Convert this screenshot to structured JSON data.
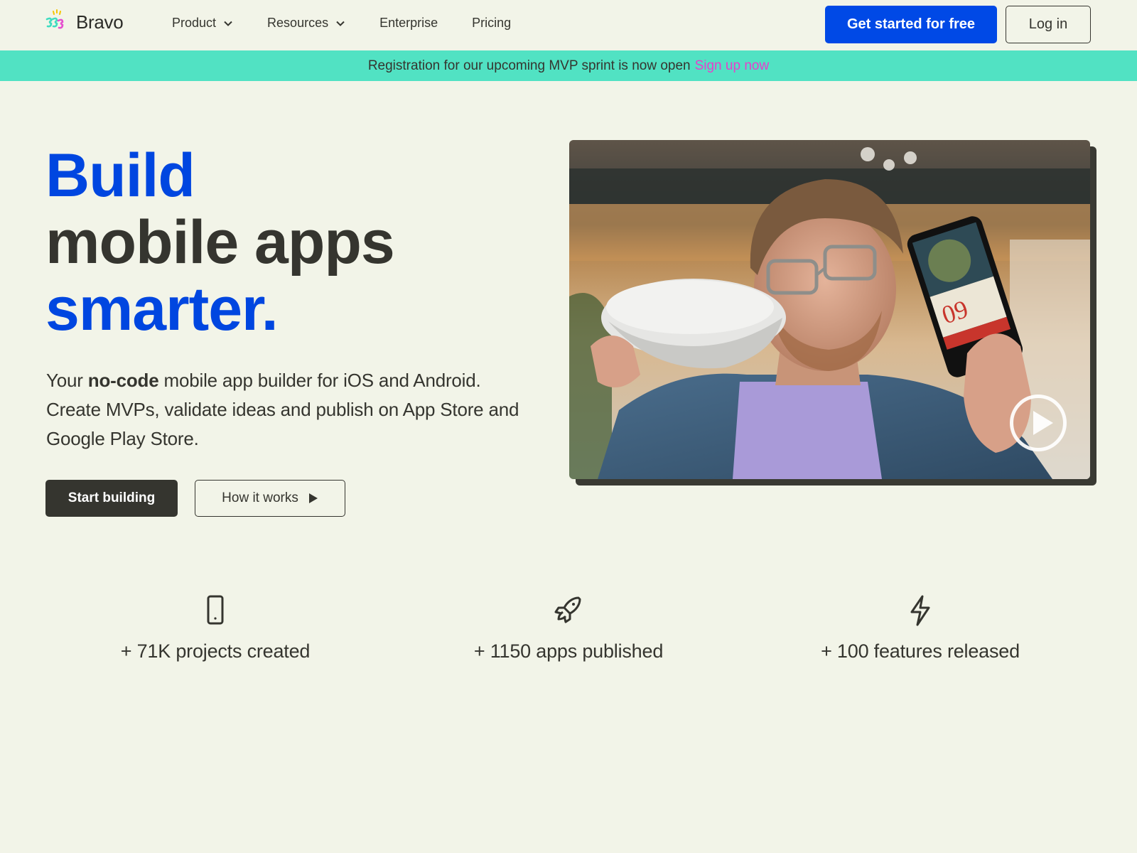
{
  "nav": {
    "brand": "Bravo",
    "links": [
      {
        "label": "Product",
        "has_dropdown": true
      },
      {
        "label": "Resources",
        "has_dropdown": true
      },
      {
        "label": "Enterprise",
        "has_dropdown": false
      },
      {
        "label": "Pricing",
        "has_dropdown": false
      }
    ],
    "cta_label": "Get started for free",
    "login_label": "Log in"
  },
  "banner": {
    "text": "Registration for our upcoming MVP sprint is now open",
    "link_label": "Sign up now"
  },
  "hero": {
    "title_line1": "Build",
    "title_line2": "mobile apps",
    "title_line3": "smarter.",
    "desc_prefix": "Your ",
    "desc_bold": "no-code",
    "desc_suffix": " mobile app builder for iOS and Android. Create MVPs, validate ideas and publish on App Store and Google Play Store.",
    "primary_button": "Start building",
    "secondary_button": "How it works",
    "video": {
      "icon": "play-circle-icon",
      "phone_screen_text": "09"
    }
  },
  "stats": [
    {
      "icon": "smartphone-icon",
      "label": "+ 71K projects created"
    },
    {
      "icon": "rocket-icon",
      "label": "+ 1150 apps published"
    },
    {
      "icon": "lightning-icon",
      "label": "+ 100 features released"
    }
  ],
  "colors": {
    "background": "#f2f4e8",
    "brand_blue": "#0046e0",
    "banner": "#51e2c3",
    "banner_link": "#e83fcb",
    "text_dark": "#35352f"
  }
}
